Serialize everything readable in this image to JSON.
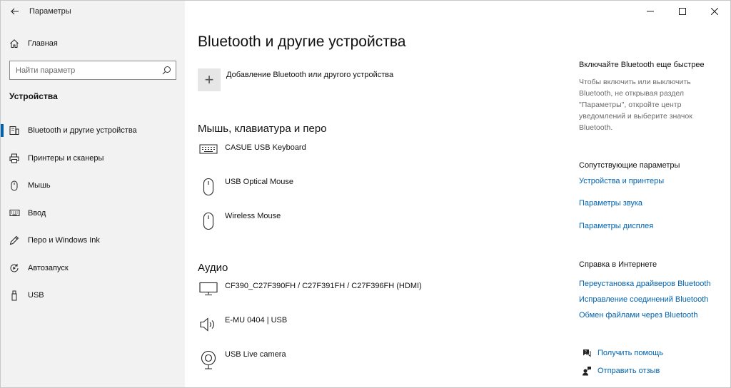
{
  "window": {
    "app_title": "Параметры"
  },
  "sidebar": {
    "home_label": "Главная",
    "search_placeholder": "Найти параметр",
    "section_title": "Устройства",
    "items": [
      {
        "label": "Bluetooth и другие устройства",
        "icon": "bluetooth-devices-icon",
        "active": true
      },
      {
        "label": "Принтеры и сканеры",
        "icon": "printer-icon"
      },
      {
        "label": "Мышь",
        "icon": "mouse-icon"
      },
      {
        "label": "Ввод",
        "icon": "keyboard-icon"
      },
      {
        "label": "Перо и Windows Ink",
        "icon": "pen-icon"
      },
      {
        "label": "Автозапуск",
        "icon": "autoplay-icon"
      },
      {
        "label": "USB",
        "icon": "usb-icon"
      }
    ]
  },
  "main": {
    "title": "Bluetooth и другие устройства",
    "add_device_label": "Добавление Bluetooth или другого устройства",
    "groups": [
      {
        "title": "Мышь, клавиатура и перо",
        "devices": [
          {
            "name": "CASUE USB Keyboard",
            "icon": "keyboard-icon"
          },
          {
            "name": "USB Optical Mouse",
            "icon": "mouse-icon"
          },
          {
            "name": "Wireless Mouse",
            "icon": "mouse-icon"
          }
        ]
      },
      {
        "title": "Аудио",
        "devices": [
          {
            "name": "CF390_C27F390FH / C27F391FH / C27F396FH (HDMI)",
            "icon": "monitor-icon"
          },
          {
            "name": "E-MU 0404 | USB",
            "icon": "speaker-icon"
          },
          {
            "name": "USB Live camera",
            "icon": "webcam-icon"
          }
        ]
      }
    ]
  },
  "rail": {
    "tip_heading": "Включайте Bluetooth еще быстрее",
    "tip_text": "Чтобы включить или выключить Bluetooth, не открывая раздел \"Параметры\", откройте центр уведомлений и выберите значок Bluetooth.",
    "related_heading": "Сопутствующие параметры",
    "related_links": [
      "Устройства и принтеры",
      "Параметры звука",
      "Параметры дисплея"
    ],
    "web_help_heading": "Справка в Интернете",
    "web_help_links": [
      "Переустановка драйверов Bluetooth",
      "Исправление соединений Bluetooth",
      "Обмен файлами через Bluetooth"
    ],
    "get_help": "Получить помощь",
    "send_feedback": "Отправить отзыв"
  },
  "colors": {
    "accent": "#0063b1",
    "sidebar_bg": "#f2f2f2",
    "muted_text": "#6b6b6b",
    "tile_bg": "#e6e6e6"
  }
}
